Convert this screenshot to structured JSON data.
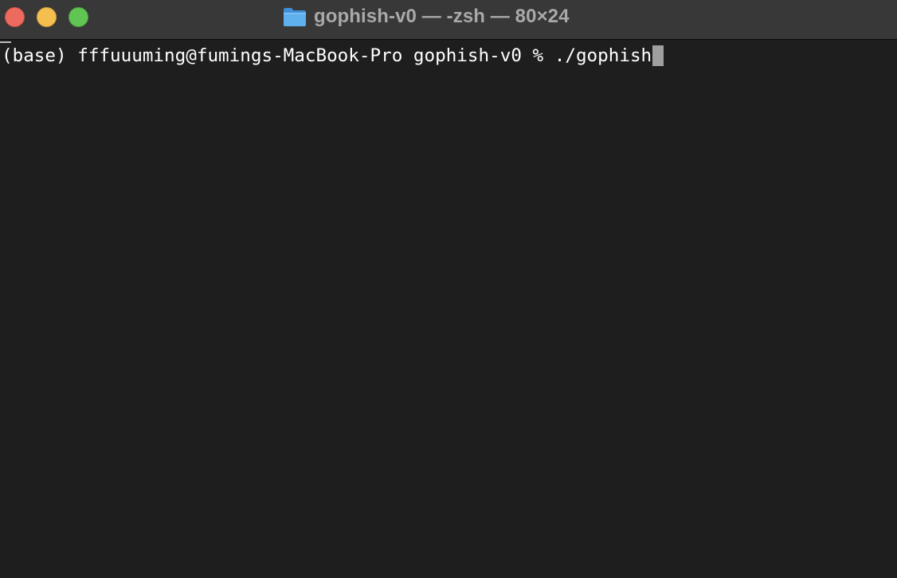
{
  "window": {
    "title": "gophish-v0 — -zsh — 80×24",
    "folder_icon": "folder-icon",
    "colors": {
      "close": "#ed6a5e",
      "minimize": "#f5bf4f",
      "zoom": "#61c554",
      "titlebar": "#383838",
      "background": "#1e1e1e"
    }
  },
  "terminal": {
    "prompt": "(base) fffuuuming@fumings-MacBook-Pro gophish-v0 % ",
    "command": "./gophish"
  }
}
